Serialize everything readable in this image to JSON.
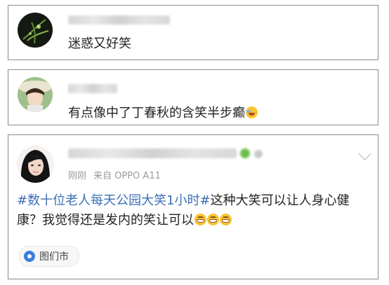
{
  "comments": [
    {
      "text": "迷惑又好笑"
    },
    {
      "text": "有点像中了丁春秋的含笑半步癫"
    }
  ],
  "post": {
    "time": "刚刚",
    "source": "来自 OPPO A11",
    "hashtag": "#数十位老人每天公园大笑1小时#",
    "body": "这种大笑可以让人身心健康？我觉得还是发内的笑让可以",
    "location": "图们市"
  },
  "colors": {
    "link": "#3b6fb6",
    "meta": "#9a9a9a",
    "location_pin": "#3b7ddd",
    "border": "#8c8c8c"
  }
}
